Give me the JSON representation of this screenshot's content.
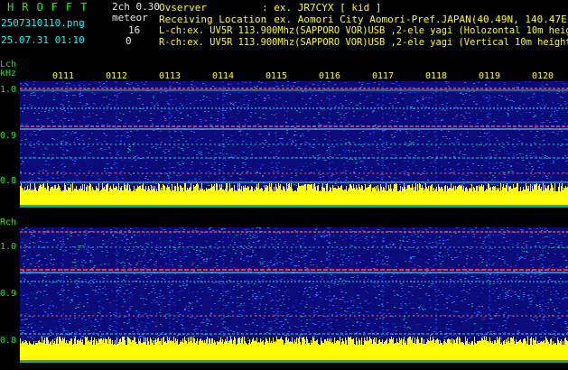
{
  "header": {
    "logo": "HROFFT",
    "filename": "2507310110.png",
    "mode": "2ch 0.30",
    "event": "meteor",
    "count_l": "16",
    "count_r": "0",
    "datetime": "25.07.31 01:10",
    "observer_label": "Ovserver",
    "observer_value": ": ex. JR7CYX [ kid ]",
    "location_label": "Receiving Location",
    "location_value": ": ex. Aomori City Aomori-Pref.JAPAN(40.49N, 140.47E)",
    "lch_info": "L-ch:ex. UV5R 113.900Mhz(SAPPORO VOR)USB ,2-ele yagi (Holozontal 10m height)",
    "rch_info": "R-ch:ex. UV5R 113.900Mhz(SAPPORO VOR)USB ,2-ele yagi (Vertical 10m height)"
  },
  "lch": {
    "label": "Lch",
    "unit": "kHz",
    "ticks": [
      "0111",
      "0112",
      "0113",
      "0114",
      "0115",
      "0116",
      "0117",
      "0118",
      "0119",
      "0120"
    ],
    "y_labels": [
      "1.0",
      "0.9",
      "0.8"
    ]
  },
  "rch": {
    "label": "Rch",
    "y_labels": [
      "1.0",
      "0.9",
      "0.8"
    ]
  },
  "colors": {
    "background": "#0b0b7a",
    "signal": "#ffff00",
    "text_cyan": "#00ffff",
    "text_green": "#00ff00"
  }
}
